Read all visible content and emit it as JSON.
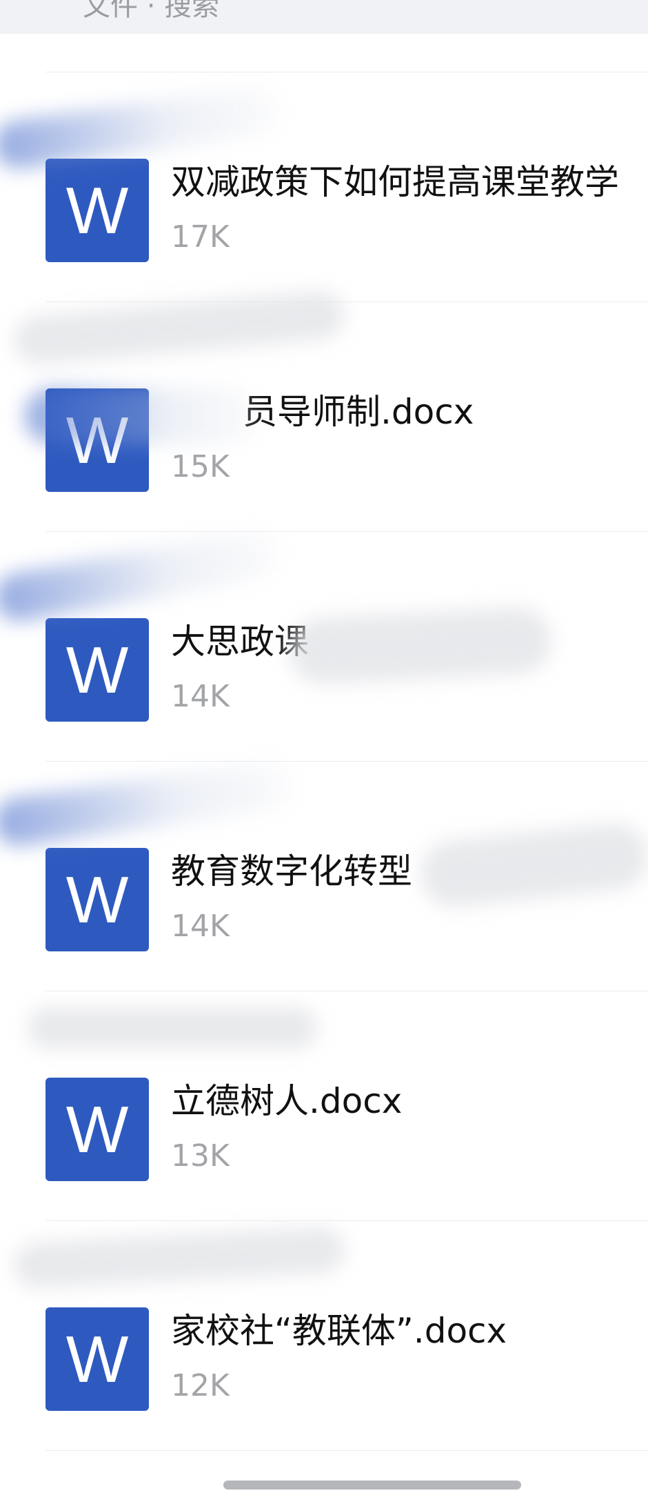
{
  "header": {
    "title": "文件 · 搜索"
  },
  "files": [
    {
      "name": "双减政策下如何提高课堂教学",
      "size": "17K",
      "icon": "word-document-icon"
    },
    {
      "name": "员导师制.docx",
      "size": "15K",
      "icon": "word-document-icon"
    },
    {
      "name": "大思政课",
      "size": "14K",
      "icon": "word-document-icon"
    },
    {
      "name": "教育数字化转型",
      "size": "14K",
      "icon": "word-document-icon"
    },
    {
      "name": "立德树人.docx",
      "size": "13K",
      "icon": "word-document-icon"
    },
    {
      "name": "家校社“教联体”.docx",
      "size": "12K",
      "icon": "word-document-icon"
    }
  ],
  "colors": {
    "word_icon_bg": "#2e5ac0",
    "size_text": "#a3a4a8",
    "header_bg": "#f1f2f5"
  }
}
